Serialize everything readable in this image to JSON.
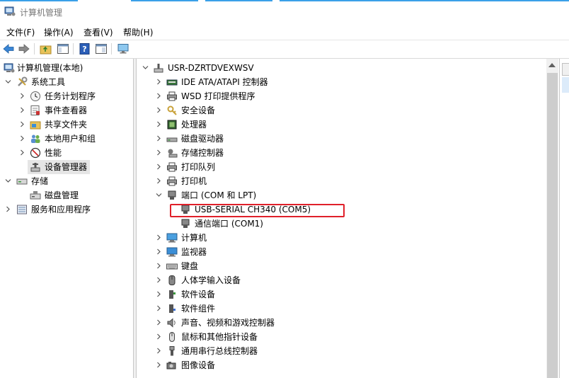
{
  "window": {
    "title": "计算机管理"
  },
  "menu": {
    "file": "文件(F)",
    "action": "操作(A)",
    "view": "查看(V)",
    "help": "帮助(H)"
  },
  "left_tree": {
    "root": "计算机管理(本地)",
    "system_tools": "系统工具",
    "task_scheduler": "任务计划程序",
    "event_viewer": "事件查看器",
    "shared_folders": "共享文件夹",
    "local_users": "本地用户和组",
    "performance": "性能",
    "device_manager": "设备管理器",
    "storage": "存储",
    "disk_management": "磁盘管理",
    "services_apps": "服务和应用程序"
  },
  "device_tree": {
    "computer_name": "USR-DZRTDVEXWSV",
    "categories": [
      "IDE ATA/ATAPI 控制器",
      "WSD 打印提供程序",
      "安全设备",
      "处理器",
      "磁盘驱动器",
      "存储控制器",
      "打印队列",
      "打印机",
      "端口 (COM 和 LPT)",
      "计算机",
      "监视器",
      "键盘",
      "人体学输入设备",
      "软件设备",
      "软件组件",
      "声音、视频和游戏控制器",
      "鼠标和其他指针设备",
      "通用串行总线控制器",
      "图像设备"
    ],
    "ports_children": [
      "USB-SERIAL CH340 (COM5)",
      "通信端口 (COM1)"
    ]
  },
  "colors": {
    "highlight_box": "#e0202a",
    "selection": "#e5e5e5"
  }
}
